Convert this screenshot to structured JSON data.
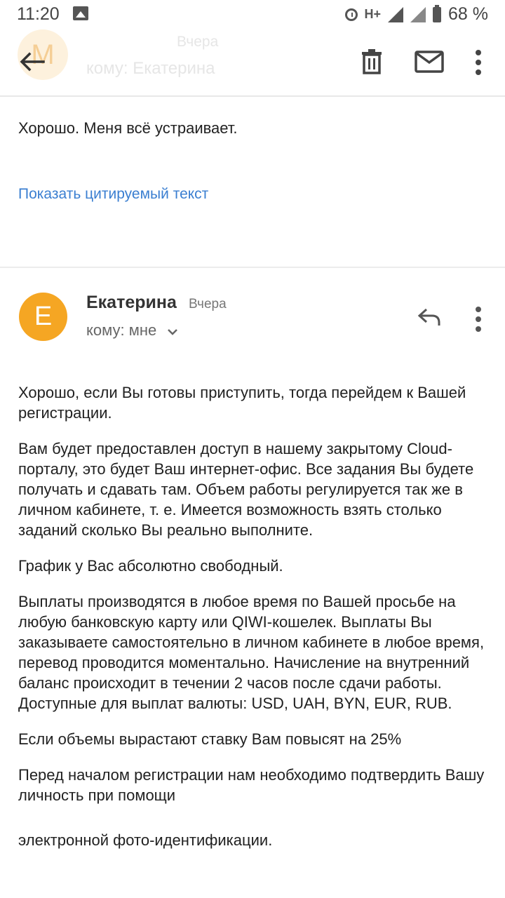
{
  "status_bar": {
    "time": "11:20",
    "network": "H+",
    "battery": "68 %"
  },
  "header": {
    "faded_avatar_letter": "M",
    "faded_date": "Вчера",
    "faded_to": "кому: Екатерина"
  },
  "first_message": {
    "text": "Хорошо. Меня всё устраивает.",
    "show_quoted": "Показать цитируемый текст"
  },
  "second_message": {
    "avatar_letter": "Е",
    "sender": "Екатерина",
    "date": "Вчера",
    "recipient": "кому: мне",
    "paragraphs": [
      "Хорошо, если Вы готовы приступить, тогда перейдем к Вашей регистрации.",
      "Вам будет предоставлен доступ в нашему закрытому Cloud-порталу, это будет Ваш интернет-офис. Все задания Вы будете получать и сдавать там. Объем работы регулируется так же в личном кабинете, т. е. Имеется возможность взять столько заданий сколько Вы реально выполните.",
      "График у Вас абсолютно свободный.",
      "Выплаты производятся в любое время по Вашей просьбе на любую банковскую карту или QIWI-кошелек. Выплаты Вы заказываете самостоятельно в личном кабинете в любое время, перевод проводится моментально. Начисление на внутренний баланс происходит в течении 2 часов после сдачи работы. Доступные для выплат валюты: USD, UAH, BYN, EUR, RUB.",
      "Если объемы вырастают ставку Вам повысят на 25%",
      "Перед началом регистрации нам необходимо подтвердить Вашу личность при помощи",
      "электронной фото-идентификации."
    ]
  },
  "colors": {
    "accent_link": "#3b7fd1",
    "avatar": "#f5a623"
  }
}
